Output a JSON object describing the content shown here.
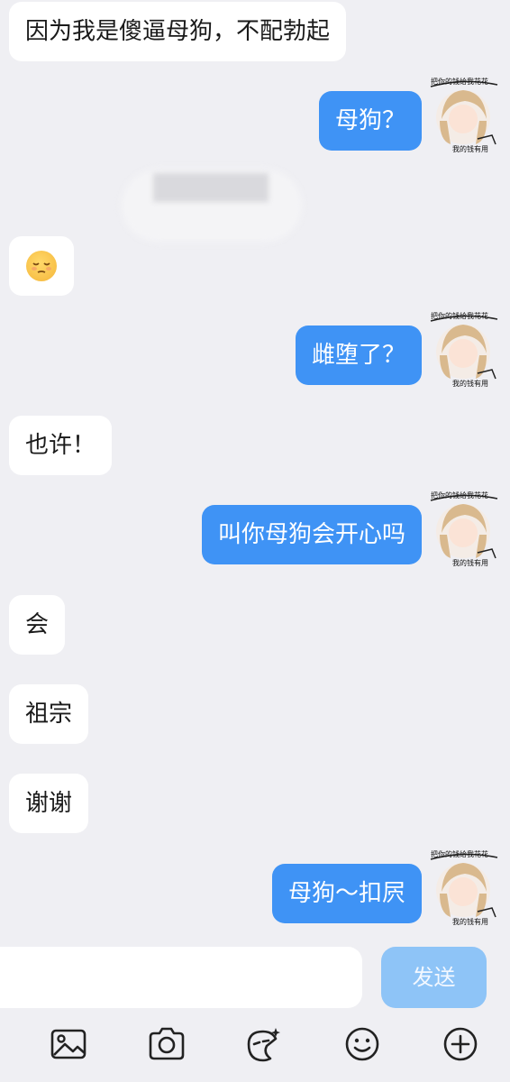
{
  "messages": [
    {
      "side": "in",
      "text": "因为我是傻逼母狗，不配勃起"
    },
    {
      "side": "out",
      "text": "母狗？"
    },
    {
      "side": "in",
      "text": "",
      "emoji": "relieved-face"
    },
    {
      "side": "out",
      "text": "雌堕了？"
    },
    {
      "side": "in",
      "text": "也许！"
    },
    {
      "side": "out",
      "text": "叫你母狗会开心吗"
    },
    {
      "side": "in",
      "text": "会"
    },
    {
      "side": "in",
      "text": "祖宗"
    },
    {
      "side": "in",
      "text": "谢谢"
    },
    {
      "side": "out",
      "text": "母狗～扣屄"
    }
  ],
  "avatar": {
    "top_caption": "把你的钱给我花花",
    "bottom_caption": "我的钱有用"
  },
  "composer": {
    "input_value": "",
    "send_label": "发送"
  },
  "toolbar": {
    "icons": [
      "image-icon",
      "camera-icon",
      "sticker-icon",
      "emoji-icon",
      "plus-icon"
    ]
  },
  "colors": {
    "background": "#efeff3",
    "outgoing_bubble": "#3f93f5",
    "incoming_bubble": "#ffffff",
    "send_button": "#8ec4f7"
  }
}
